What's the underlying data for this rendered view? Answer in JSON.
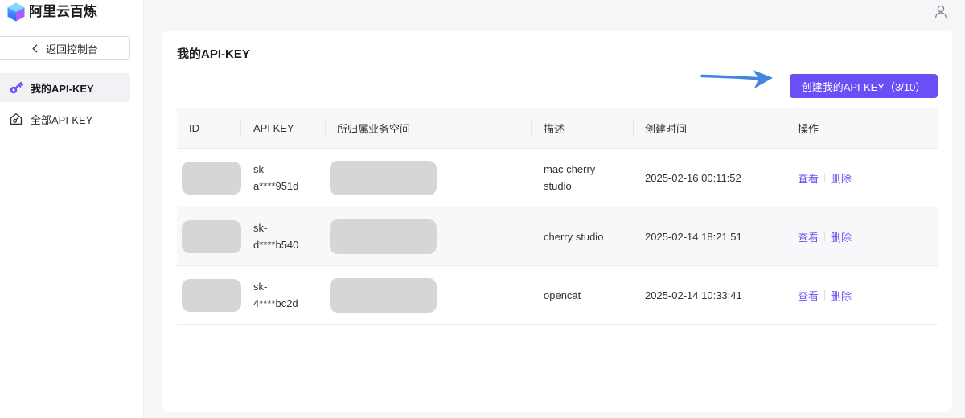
{
  "app": {
    "name": "阿里云百炼",
    "logo_icon": "bailian-logo-icon"
  },
  "sidebar": {
    "back_button": {
      "label": "返回控制台",
      "icon": "chevron-left-icon"
    },
    "items": [
      {
        "label": "我的API-KEY",
        "icon": "key-icon",
        "active": true
      },
      {
        "label": "全部API-KEY",
        "icon": "house-key-icon",
        "active": false
      }
    ]
  },
  "topbar": {
    "user_icon": "user-icon"
  },
  "main": {
    "title": "我的API-KEY",
    "annotation": {
      "icon": "arrow-right-icon"
    },
    "create_button": {
      "label": "创建我的API-KEY（3/10）"
    },
    "table": {
      "columns": [
        "ID",
        "API KEY",
        "所归属业务空间",
        "描述",
        "创建时间",
        "操作"
      ],
      "rows": [
        {
          "id_redacted": true,
          "api_key": "sk-a****951d",
          "workspace_redacted": true,
          "description": "mac cherry studio",
          "created_at": "2025-02-16 00:11:52",
          "view_label": "查看",
          "delete_label": "删除",
          "highlighted": false
        },
        {
          "id_redacted": true,
          "api_key": "sk-d****b540",
          "workspace_redacted": true,
          "description": "cherry studio",
          "created_at": "2025-02-14 18:21:51",
          "view_label": "查看",
          "delete_label": "删除",
          "highlighted": true
        },
        {
          "id_redacted": true,
          "api_key": "sk-4****bc2d",
          "workspace_redacted": true,
          "description": "opencat",
          "created_at": "2025-02-14 10:33:41",
          "view_label": "查看",
          "delete_label": "删除",
          "highlighted": false
        }
      ]
    }
  },
  "colors": {
    "accent": "#6b4ef6",
    "link": "#6b50f0",
    "annotation_arrow": "#4286e0",
    "redaction_mask": "#d6d6d6",
    "row_highlight": "#f7f8fa"
  }
}
